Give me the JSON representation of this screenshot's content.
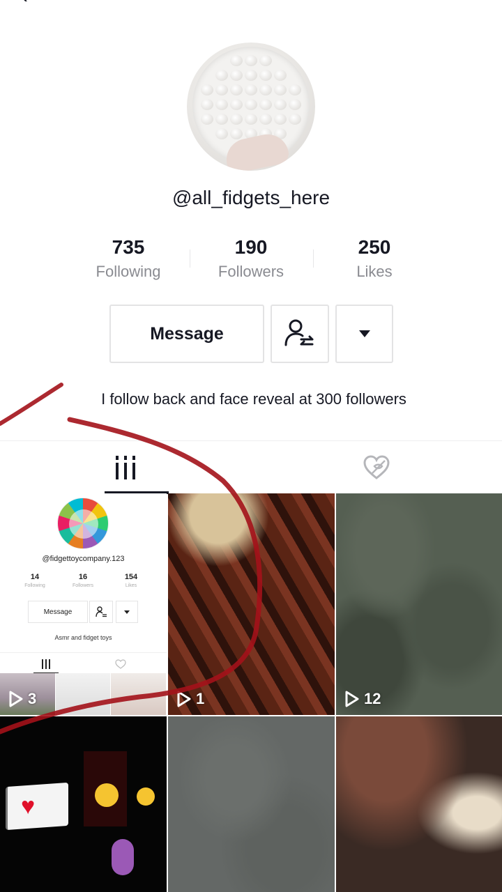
{
  "profile": {
    "username": "@all_fidgets_here",
    "bio": "I follow back and face reveal at 300 followers",
    "stats": [
      {
        "value": "735",
        "label": "Following"
      },
      {
        "value": "190",
        "label": "Followers"
      },
      {
        "value": "250",
        "label": "Likes"
      }
    ]
  },
  "actions": {
    "message_label": "Message",
    "follow_icon": "person-swap-icon",
    "dropdown_icon": "caret-down-icon"
  },
  "tabs": {
    "videos_icon": "grid-bars-icon",
    "liked_icon": "heart-hidden-icon"
  },
  "videos": [
    {
      "views": "3"
    },
    {
      "views": "1"
    },
    {
      "views": "12"
    }
  ],
  "embedded_profile": {
    "username": "@fidgettoycompany.123",
    "stats": [
      {
        "value": "14",
        "label": "Following"
      },
      {
        "value": "16",
        "label": "Followers"
      },
      {
        "value": "154",
        "label": "Likes"
      }
    ],
    "message_label": "Message",
    "bio": "Asmr and fidget toys"
  },
  "colors": {
    "text": "#161823",
    "muted": "#8a8b91",
    "border": "#e3e3e4",
    "scribble": "#a3121a"
  }
}
